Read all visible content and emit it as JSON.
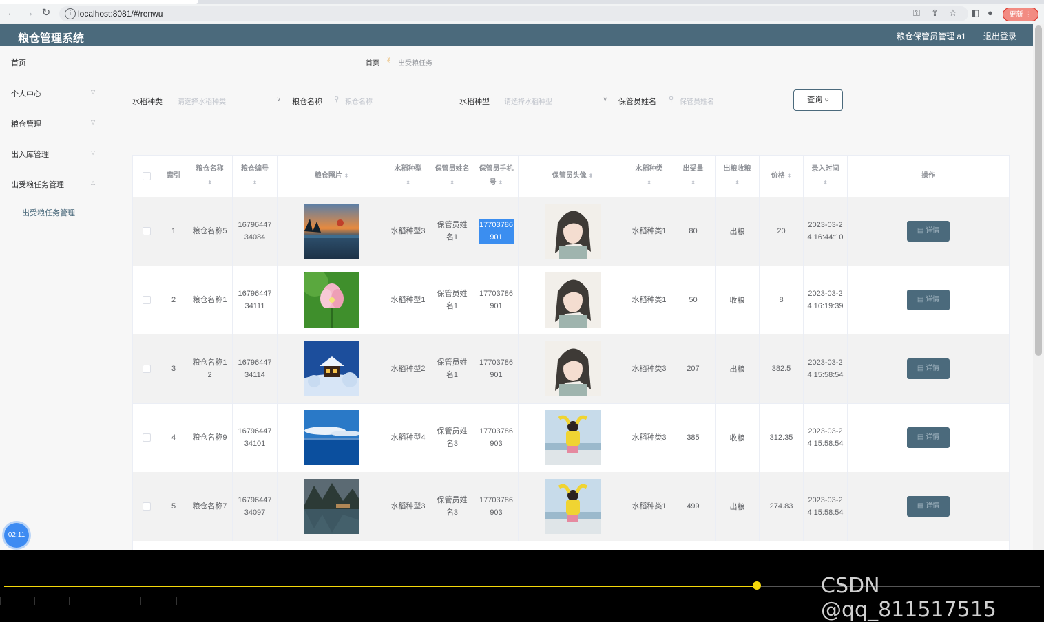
{
  "browser": {
    "url": "localhost:8081/#/renwu",
    "update_label": "更新"
  },
  "header": {
    "title": "粮仓管理系统",
    "user": "粮仓保管员管理 a1",
    "logout": "退出登录"
  },
  "sidebar": {
    "items": [
      {
        "label": "首页"
      },
      {
        "label": "个人中心"
      },
      {
        "label": "粮仓管理"
      },
      {
        "label": "出入库管理"
      },
      {
        "label": "出受粮任务管理"
      }
    ],
    "sub_item": "出受粮任务管理"
  },
  "breadcrumb": {
    "home": "首页",
    "current": "出受粮任务"
  },
  "filters": {
    "rice_kind_label": "水稻种类",
    "rice_kind_placeholder": "请选择水稻种类",
    "granary_name_label": "粮仓名称",
    "granary_name_placeholder": "粮仓名称",
    "rice_type_label": "水稻种型",
    "rice_type_placeholder": "请选择水稻种型",
    "keeper_name_label": "保管员姓名",
    "keeper_name_placeholder": "保管员姓名",
    "query_label": "查询"
  },
  "table": {
    "headers": {
      "index": "索引",
      "granary_name": "粮仓名称",
      "granary_no": "粮仓编号",
      "granary_photo": "粮仓照片",
      "rice_type": "水稻种型",
      "keeper_name": "保管员姓名",
      "keeper_phone": "保管员手机号",
      "keeper_avatar": "保管员头像",
      "rice_kind": "水稻种类",
      "amount": "出受量",
      "direction": "出粮收粮",
      "price": "价格",
      "entry_time": "录入时间",
      "actions": "操作"
    },
    "detail_label": "详情",
    "rows": [
      {
        "index": "1",
        "granary_name": "粮仓名称5",
        "granary_no": "1679644734084",
        "photo": "sunset-lake",
        "rice_type": "水稻种型3",
        "keeper_name": "保管员姓名1",
        "keeper_phone": "17703786901",
        "avatar": "avatar-girl-drawing",
        "rice_kind": "水稻种类1",
        "amount": "80",
        "direction": "出粮",
        "price": "20",
        "entry_time": "2023-03-24 16:44:10"
      },
      {
        "index": "2",
        "granary_name": "粮仓名称1",
        "granary_no": "1679644734111",
        "photo": "lotus-flower",
        "rice_type": "水稻种型1",
        "keeper_name": "保管员姓名1",
        "keeper_phone": "17703786901",
        "avatar": "avatar-girl-drawing",
        "rice_kind": "水稻种类1",
        "amount": "50",
        "direction": "收粮",
        "price": "8",
        "entry_time": "2023-03-24 16:19:39"
      },
      {
        "index": "3",
        "granary_name": "粮仓名称12",
        "granary_no": "1679644734114",
        "photo": "snow-cabin",
        "rice_type": "水稻种型2",
        "keeper_name": "保管员姓名1",
        "keeper_phone": "17703786901",
        "avatar": "avatar-girl-drawing",
        "rice_kind": "水稻种类3",
        "amount": "207",
        "direction": "出粮",
        "price": "382.5",
        "entry_time": "2023-03-24 15:58:54"
      },
      {
        "index": "4",
        "granary_name": "粮仓名称9",
        "granary_no": "1679644734101",
        "photo": "blue-sea",
        "rice_type": "水稻种型4",
        "keeper_name": "保管员姓名3",
        "keeper_phone": "17703786903",
        "avatar": "avatar-girl-yellow",
        "rice_kind": "水稻种类3",
        "amount": "385",
        "direction": "收粮",
        "price": "312.35",
        "entry_time": "2023-03-24 15:58:54"
      },
      {
        "index": "5",
        "granary_name": "粮仓名称7",
        "granary_no": "1679644734097",
        "photo": "mountain-village",
        "rice_type": "水稻种型3",
        "keeper_name": "保管员姓名3",
        "keeper_phone": "17703786903",
        "avatar": "avatar-girl-yellow",
        "rice_kind": "水稻种类1",
        "amount": "499",
        "direction": "出粮",
        "price": "274.83",
        "entry_time": "2023-03-24 15:58:54"
      }
    ]
  },
  "timer": "02:11",
  "player": {
    "progress": 0.727
  },
  "watermark": "CSDN @qq_811517515",
  "colors": {
    "header_bg": "#4b6a7c",
    "accent": "#4b6a7c",
    "highlight": "#3b8ef0",
    "progress": "#f5d90a"
  }
}
